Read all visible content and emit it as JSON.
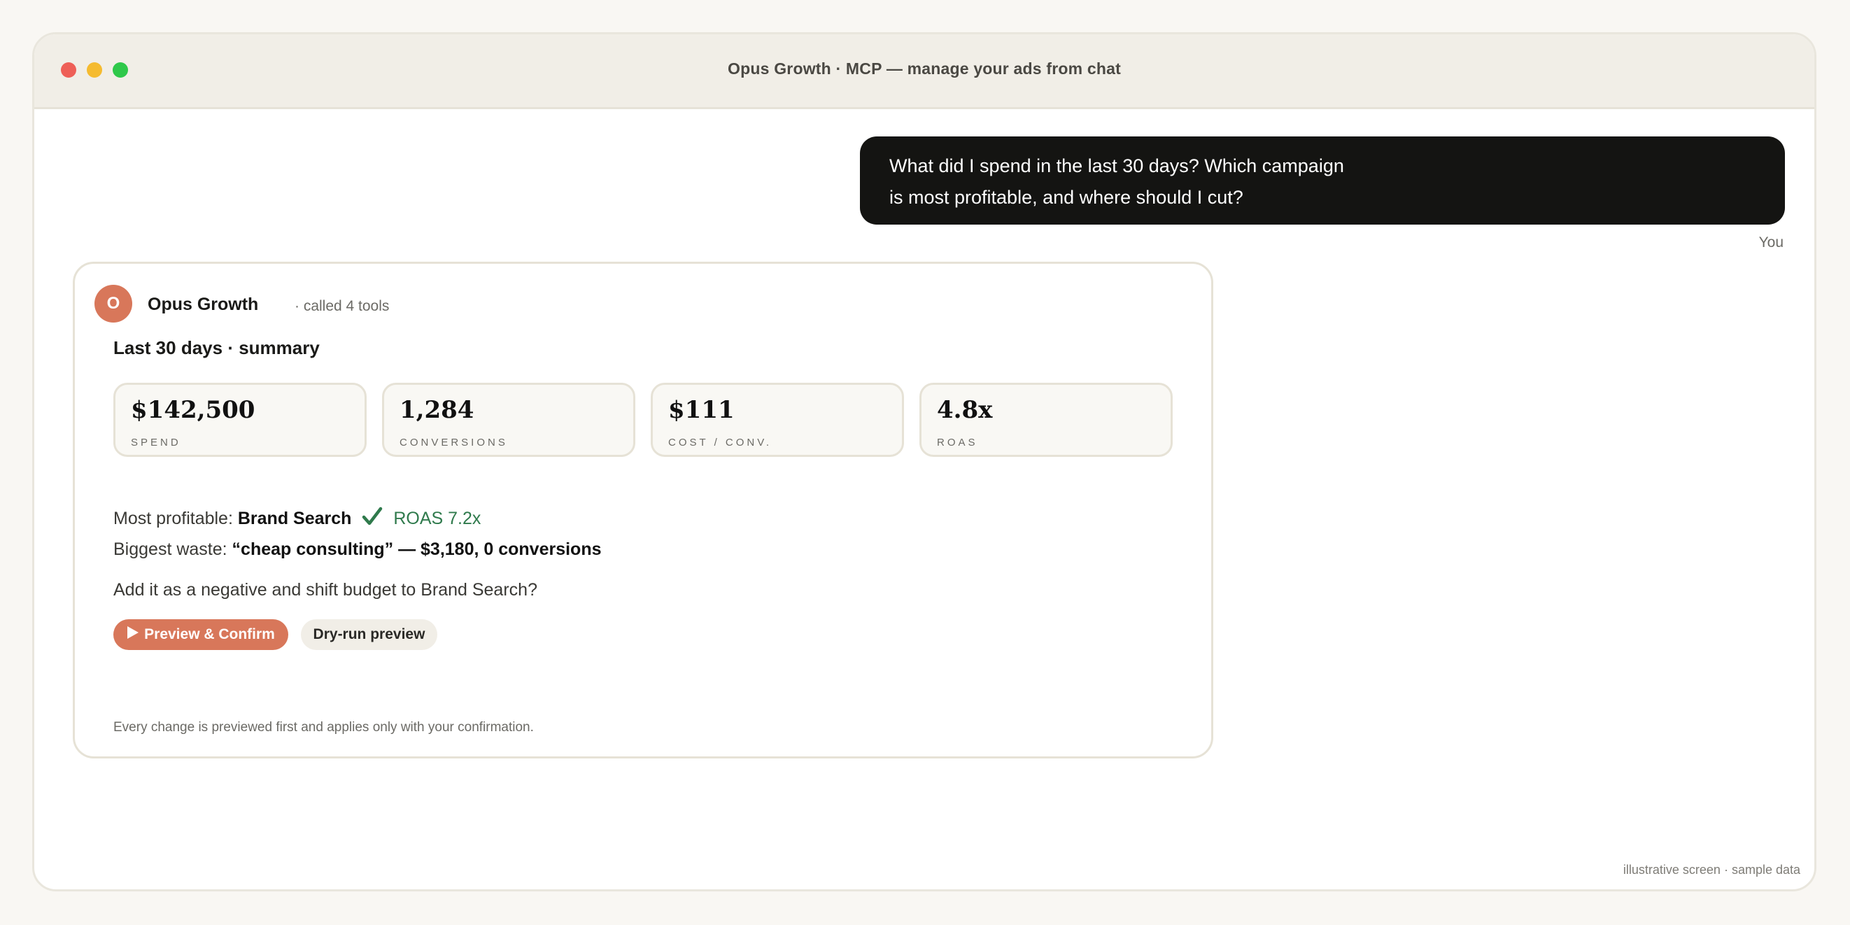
{
  "window": {
    "title": "Opus Growth · MCP — manage your ads from chat"
  },
  "user_message": {
    "line1": "What did I spend in the last 30 days? Which campaign",
    "line2": "is most profitable, and where should I cut?",
    "sender": "You"
  },
  "reply": {
    "avatar_initial": "O",
    "agent_name": "Opus Growth",
    "tools_called": "· called 4 tools",
    "summary_heading": "Last 30 days · summary",
    "metrics": [
      {
        "value": "$142,500",
        "label": "SPEND"
      },
      {
        "value": "1,284",
        "label": "CONVERSIONS"
      },
      {
        "value": "$111",
        "label": "COST / CONV."
      },
      {
        "value": "4.8x",
        "label": "ROAS"
      }
    ],
    "most_profitable_label": "Most profitable:",
    "most_profitable_value": "Brand Search",
    "most_profitable_roas": "ROAS 7.2x",
    "biggest_waste_label": "Biggest waste:",
    "biggest_waste_value": "“cheap consulting” — $3,180, 0 conversions",
    "question": "Add it as a negative and shift budget to Brand Search?",
    "primary_action": "Preview & Confirm",
    "secondary_action": "Dry-run preview",
    "footnote": "Every change is previewed first and applies only with your confirmation."
  },
  "watermark": "illustrative screen · sample data",
  "colors": {
    "accent": "#d8775a",
    "user_bubble": "#141412",
    "success": "#2f7a4c",
    "background": "#f9f7f3"
  },
  "icons": {
    "check": "check-icon",
    "play": "play-icon"
  }
}
